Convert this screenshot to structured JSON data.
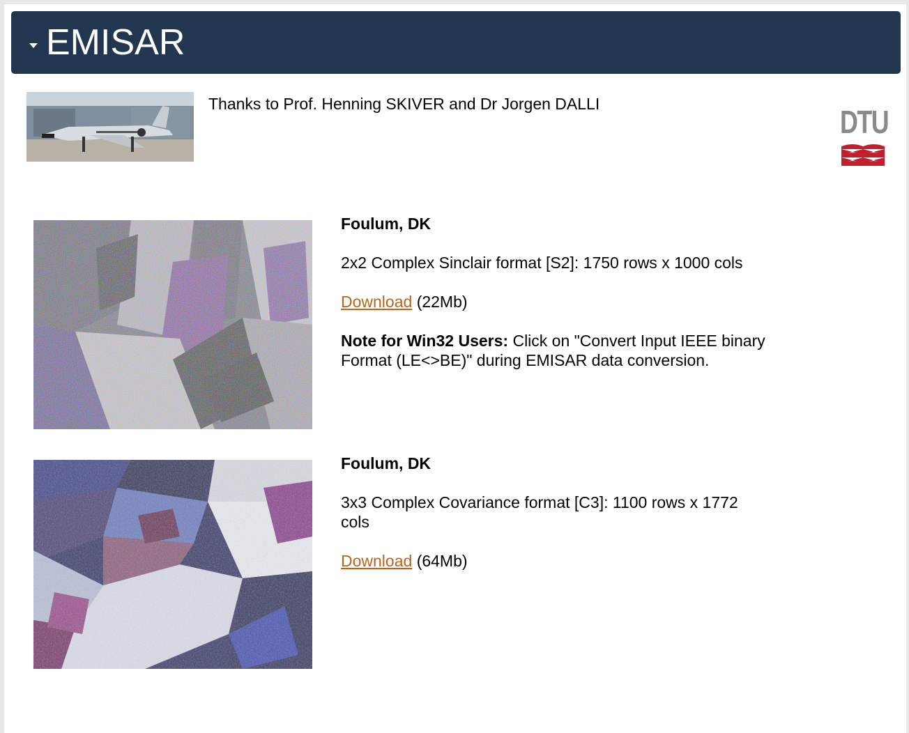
{
  "header": {
    "title": "EMISAR"
  },
  "intro": {
    "thanks_text": "Thanks to Prof. Henning SKIVER and Dr Jorgen DALLI"
  },
  "logo": {
    "text": "DTU",
    "color": "#c41e2a"
  },
  "datasets": [
    {
      "title": "Foulum, DK",
      "format": "2x2 Complex Sinclair format [S2]: 1750 rows x 1000 cols",
      "download_label": "Download",
      "size": "(22Mb)",
      "note_label": "Note for Win32 Users:",
      "note_text": " Click on \"Convert Input IEEE binary Format (LE<>BE)\" during EMISAR data conversion."
    },
    {
      "title": "Foulum, DK",
      "format": "3x3 Complex Covariance format [C3]: 1100 rows x 1772 cols",
      "download_label": "Download",
      "size": "(64Mb)"
    }
  ],
  "colors": {
    "header_bg": "#22364f",
    "link": "#b8651b"
  }
}
